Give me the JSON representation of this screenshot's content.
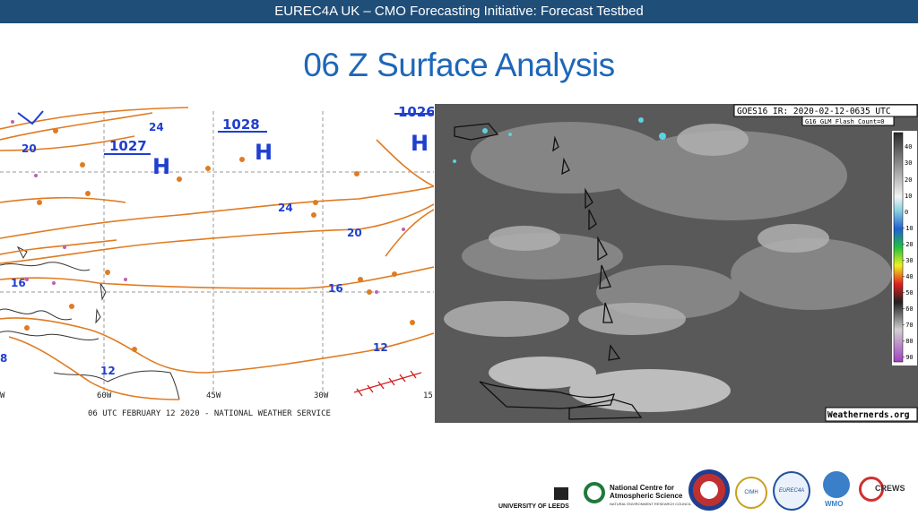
{
  "header": {
    "banner": "EUREC4A UK – CMO Forecasting Initiative: Forecast Testbed"
  },
  "slide": {
    "title": "06 Z Surface Analysis"
  },
  "surface_map": {
    "caption": "06 UTC FEBRUARY 12 2020 - NATIONAL WEATHER SERVICE",
    "longitudes": [
      "W",
      "60W",
      "45W",
      "30W",
      "15"
    ],
    "highs": [
      {
        "pressure": "1027",
        "label": "H"
      },
      {
        "pressure": "1028",
        "label": "H"
      },
      {
        "pressure": "1026",
        "label": "H"
      }
    ],
    "isobar_labels": [
      "24",
      "20",
      "16",
      "24",
      "20",
      "16",
      "12",
      "12",
      "8"
    ],
    "colors": {
      "isobar": "#e07b22",
      "high": "#1f3fd0",
      "frame": "#9a9a9a",
      "front": "#d82020"
    }
  },
  "satellite": {
    "header_line1": "GOES16 IR: 2020-02-12-0635 UTC",
    "header_line2": "G16 GLM Flash Count=0",
    "scale_values": [
      "40",
      "30",
      "20",
      "10",
      "0",
      "-10",
      "-20",
      "-30",
      "-40",
      "-50",
      "-60",
      "-70",
      "-80",
      "-90"
    ],
    "credit": "Weathernerds.org"
  },
  "logos": {
    "university": "UNIVERSITY OF LEEDS",
    "ncas_line1": "National Centre for",
    "ncas_line2": "Atmospheric Science",
    "ncas_sub": "NATURAL ENVIRONMENT RESEARCH COUNCIL",
    "cimh": "CIMH",
    "eureca": "EUREC4A",
    "wmo": "WMO",
    "crews": "CREWS"
  }
}
